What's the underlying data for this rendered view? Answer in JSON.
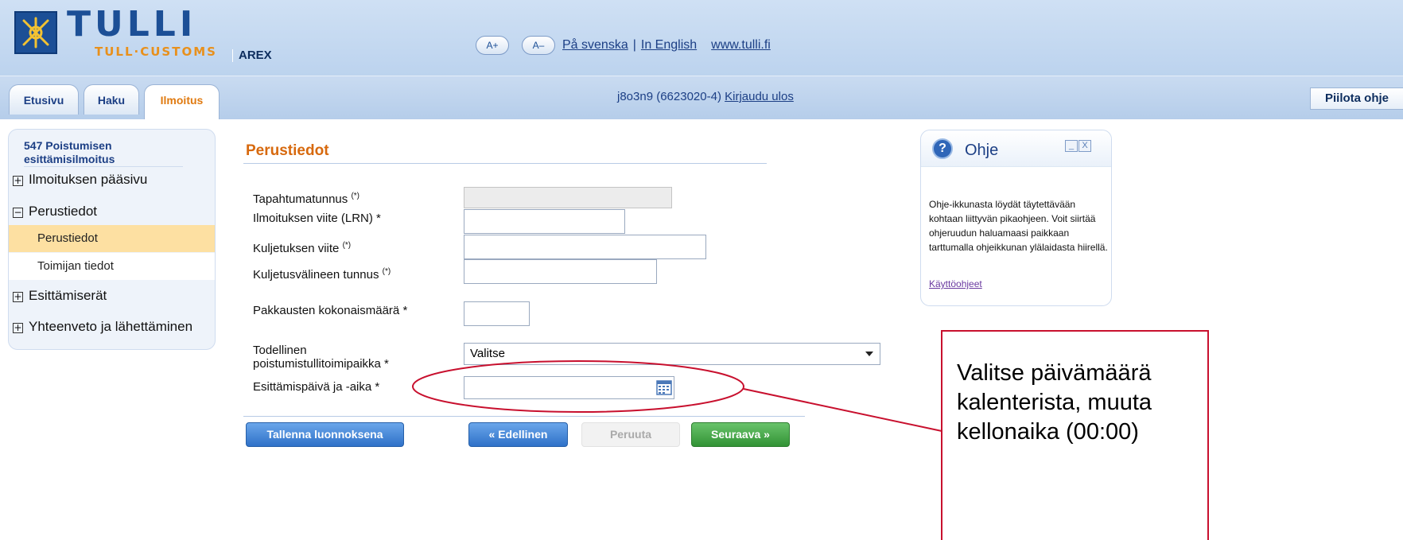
{
  "header": {
    "logo": {
      "word": "TULLI",
      "sub": "TULL·CUSTOMS"
    },
    "app_name": "AREX",
    "font_buttons": {
      "increase": "A+",
      "decrease": "A–"
    },
    "links": {
      "swedish": "På svenska",
      "separator": "|",
      "english": "In English",
      "website": "www.tulli.fi"
    },
    "tabs": [
      {
        "label": "Etusivu",
        "active": false
      },
      {
        "label": "Haku",
        "active": false
      },
      {
        "label": "Ilmoitus",
        "active": true
      }
    ],
    "user": {
      "text": "j8o3n9 (6623020-4)",
      "logout": "Kirjaudu ulos"
    },
    "hide_help": "Piilota ohje"
  },
  "sidebar": {
    "title": "547 Poistumisen esittämisilmoitus",
    "items": [
      {
        "label": "Ilmoituksen pääsivu",
        "toggle": "+"
      },
      {
        "label": "Perustiedot",
        "toggle": "−"
      },
      {
        "label": "Perustiedot",
        "selected": true
      },
      {
        "label": "Toimijan tiedot",
        "selected": false
      },
      {
        "label": "Esittämiserät",
        "toggle": "+"
      },
      {
        "label": "Yhteenveto ja lähettäminen",
        "toggle": "+"
      }
    ]
  },
  "form": {
    "section_title": "Perustiedot",
    "fields": [
      {
        "label": "Tapahtumatunnus",
        "marker": "(*)",
        "value": "",
        "disabled": true
      },
      {
        "label": "Ilmoituksen viite (LRN) *",
        "value": ""
      },
      {
        "label": "Kuljetuksen viite",
        "marker": "(*)",
        "value": ""
      },
      {
        "label": "Kuljetusvälineen tunnus",
        "marker": "(*)",
        "value": ""
      },
      {
        "label": "Pakkausten kokonaismäärä *",
        "value": ""
      },
      {
        "label_line1": "Todellinen",
        "label_line2": "poistumistullitoimipaikka *",
        "value": "Valitse"
      },
      {
        "label": "Esittämispäivä ja -aika *",
        "value": ""
      }
    ],
    "buttons": {
      "save_draft": "Tallenna luonnoksena",
      "previous": "« Edellinen",
      "cancel": "Peruuta",
      "next": "Seuraava »"
    }
  },
  "help": {
    "title": "Ohje",
    "minimize": "_",
    "close": "X",
    "text": "Ohje-ikkunasta löydät täytettävään kohtaan liittyvän pikaohjeen. Voit siirtää ohjeruudun haluamaasi paikkaan tarttumalla ohjeikkunan ylälaidasta hiirellä.",
    "link": "Käyttöohjeet"
  },
  "callout": {
    "text": "Valitse päivämäärä kalenterista, muuta kellonaika (00:00)",
    "color": "#c8102e"
  },
  "colors": {
    "brand_blue": "#1c4f96",
    "brand_orange": "#e8901c",
    "section_title": "#d7690e",
    "nav_selected": "#fde0a2"
  }
}
